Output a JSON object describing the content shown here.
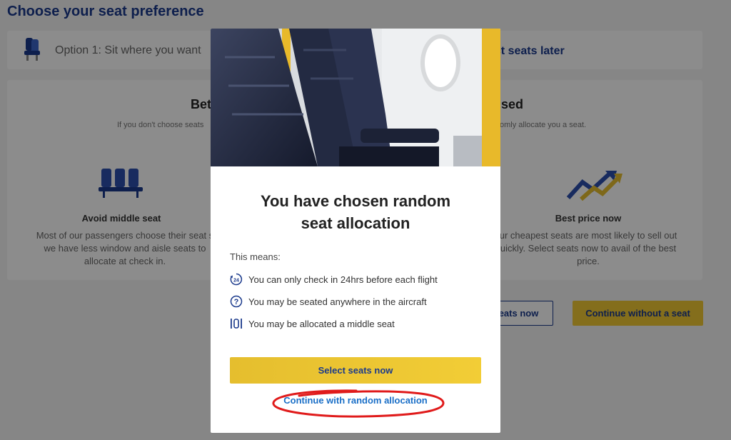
{
  "page": {
    "title": "Choose your seat preference",
    "option1_label": "Option 1: Sit where you want",
    "option2_label": "ect seats later"
  },
  "left_section": {
    "heading": "Bet",
    "subtext": "If you don't choose seats",
    "feature_title": "Avoid middle seat",
    "feature_text_l1": "Most of our passengers choose their seat s",
    "feature_text_l2": "we have less window and aisle seats to",
    "feature_text_l3": "allocate at check in."
  },
  "right_section": {
    "heading": "sed",
    "subtext": "omly allocate you a seat.",
    "feature_title": "Best price now",
    "feature_text_l1": "ur cheapest seats are most likely to sell out",
    "feature_text_l2": "uickly. Select seats now to avail of the best",
    "feature_text_l3": "price."
  },
  "background_buttons": {
    "select_label": "eats now",
    "continue_label": "Continue without a seat"
  },
  "modal": {
    "title_line1": "You have chosen random",
    "title_line2": "seat allocation",
    "means_label": "This means:",
    "bullets": [
      {
        "icon": "clock-24-icon",
        "text": "You can only check in 24hrs before each flight"
      },
      {
        "icon": "question-circle-icon",
        "text": "You may be seated anywhere in the aircraft"
      },
      {
        "icon": "middle-seat-icon",
        "text": "You may be allocated a middle seat"
      }
    ],
    "primary_button": "Select seats now",
    "secondary_link": "Continue with random allocation"
  },
  "colors": {
    "brand_blue": "#1b3a8c",
    "link_blue": "#1a6fc7",
    "accent_yellow": "#f1c933",
    "annotation_red": "#e01b1b"
  }
}
